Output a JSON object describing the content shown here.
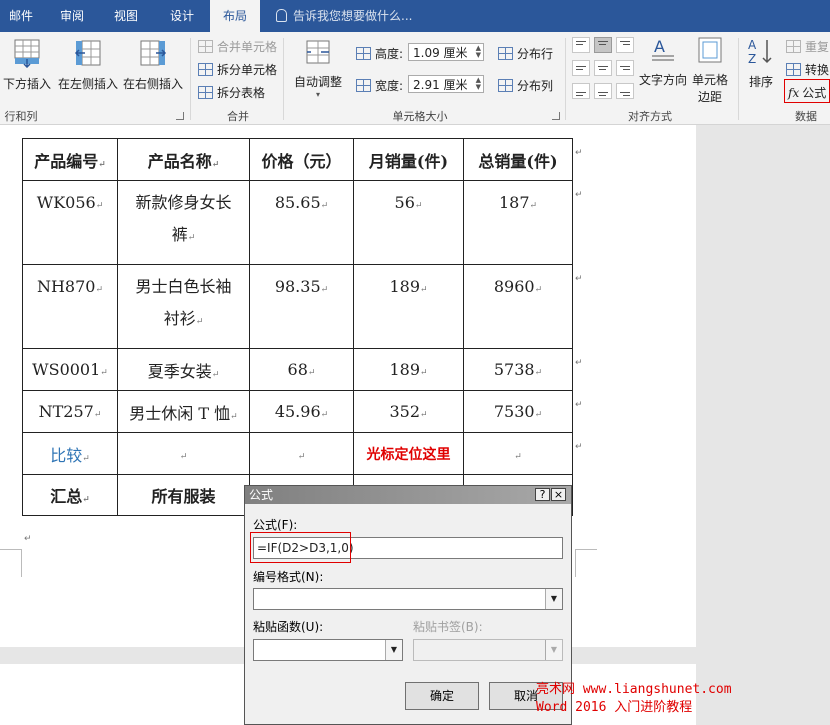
{
  "tabs": [
    {
      "label": "邮件"
    },
    {
      "label": "审阅"
    },
    {
      "label": "视图"
    },
    {
      "label": "设计"
    },
    {
      "label": "布局",
      "active": true
    }
  ],
  "tellme": "告诉我您想要做什么...",
  "ribbon": {
    "rows_cols": {
      "insert_below": "下方插入",
      "insert_left": "在左侧插入",
      "insert_right": "在右侧插入",
      "label": "行和列"
    },
    "merge": {
      "merge_cells": "合并单元格",
      "split_cells": "拆分单元格",
      "split_table": "拆分表格",
      "label": "合并"
    },
    "cell_size": {
      "autofit": "自动调整",
      "height_label": "高度:",
      "height_value": "1.09 厘米",
      "width_label": "宽度:",
      "width_value": "2.91 厘米",
      "dist_rows": "分布行",
      "dist_cols": "分布列",
      "label": "单元格大小"
    },
    "alignment": {
      "text_direction": "文字方向",
      "cell_margins_1": "单元格",
      "cell_margins_2": "边距",
      "label": "对齐方式"
    },
    "data": {
      "sort": "排序",
      "repeat_header": "重复",
      "convert": "转换",
      "formula": "公式",
      "label": "数据"
    }
  },
  "table": {
    "headers": [
      "产品编号",
      "产品名称",
      "价格（元）",
      "月销量(件)",
      "总销量(件)"
    ],
    "rows": [
      [
        "WK056",
        "新款修身女长",
        "裤",
        "85.65",
        "56",
        "187"
      ],
      [
        "NH870",
        "男士白色长袖",
        "衬衫",
        "98.35",
        "189",
        "8960"
      ],
      [
        "WS0001",
        "夏季女装",
        "",
        "68",
        "189",
        "5738"
      ],
      [
        "NT257",
        "男士休闲 T 恤",
        "",
        "45.96",
        "352",
        "7530"
      ]
    ],
    "compare_label": "比较",
    "cursor_note": "光标定位这里",
    "total_label": "汇总",
    "total_name": "所有服装"
  },
  "dialog": {
    "title": "公式",
    "help": "?",
    "close": "×",
    "formula_label": "公式(F):",
    "formula_value": "=IF(D2>D3,1,0)",
    "number_format_label": "编号格式(N):",
    "paste_function_label": "粘贴函数(U):",
    "paste_bookmark_label": "粘贴书签(B):",
    "ok": "确定",
    "cancel": "取消"
  },
  "watermark": {
    "line1": "亮术网 www.liangshunet.com",
    "line2": "Word 2016 入门进阶教程"
  },
  "colors": {
    "tab_bar": "#2b579a",
    "ribbon": "#f3f3f3",
    "highlight": "#e00000",
    "link_blue": "#2e74b5"
  }
}
